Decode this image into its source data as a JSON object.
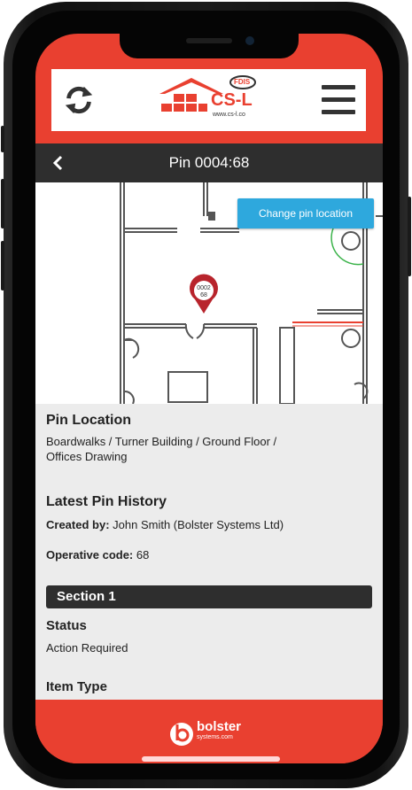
{
  "header": {
    "refresh_icon": "refresh-icon",
    "logo_text": "CS-L",
    "logo_badge": "FDIS",
    "logo_url": "www.cs-l.co",
    "menu_icon": "hamburger-menu-icon"
  },
  "titlebar": {
    "back_icon": "chevron-left-icon",
    "title": "Pin 0004:68"
  },
  "map": {
    "change_location_label": "Change pin location",
    "pin_line1": "0002",
    "pin_line2": "68"
  },
  "pin_location": {
    "heading": "Pin Location",
    "path_line1": "Boardwalks / Turner Building / Ground Floor /",
    "path_line2": "Offices Drawing"
  },
  "history": {
    "heading": "Latest Pin History",
    "created_by_label": "Created by:",
    "created_by_value": " John Smith (Bolster Systems Ltd)",
    "operative_label": "Operative code:",
    "operative_value": " 68"
  },
  "section": {
    "title": "Section 1",
    "status_label": "Status",
    "status_value": "Action Required",
    "item_type_label": "Item Type"
  },
  "footer": {
    "brand": "bolster",
    "brand_sub": "systems.com"
  },
  "colors": {
    "brand_red": "#e94030",
    "dark_bar": "#2e2e2e",
    "button_blue": "#2ea8dd"
  }
}
